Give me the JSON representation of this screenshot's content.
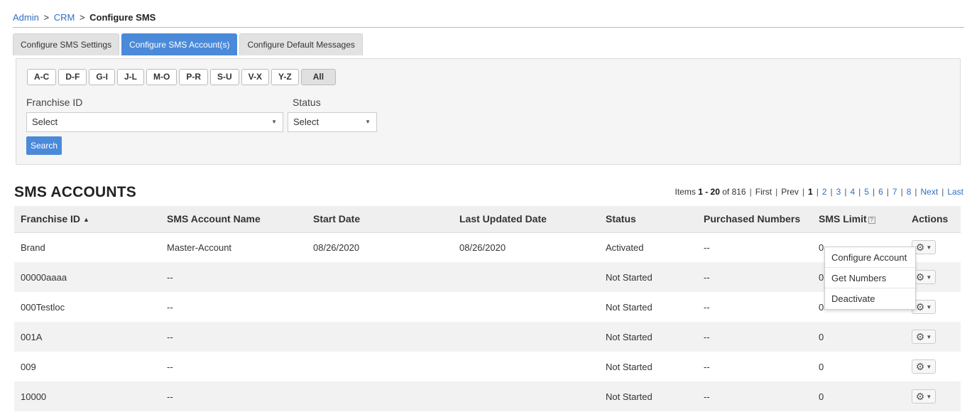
{
  "breadcrumb": {
    "admin": "Admin",
    "sep": ">",
    "crm": "CRM",
    "current": "Configure SMS"
  },
  "tabs": [
    {
      "label": "Configure SMS Settings"
    },
    {
      "label": "Configure SMS Account(s)"
    },
    {
      "label": "Configure Default Messages"
    }
  ],
  "letters": [
    "A-C",
    "D-F",
    "G-I",
    "J-L",
    "M-O",
    "P-R",
    "S-U",
    "V-X",
    "Y-Z",
    "All"
  ],
  "filters": {
    "franchise_label": "Franchise ID",
    "franchise_value": "Select",
    "status_label": "Status",
    "status_value": "Select",
    "search_label": "Search"
  },
  "section_title": "SMS ACCOUNTS",
  "pager": {
    "items_label": "Items",
    "range": "1 - 20",
    "of_label": "of 816",
    "first": "First",
    "prev": "Prev",
    "current": "1",
    "pages": [
      "2",
      "3",
      "4",
      "5",
      "6",
      "7",
      "8"
    ],
    "next": "Next",
    "last": "Last"
  },
  "table": {
    "headers": {
      "franchise_id": "Franchise ID",
      "account_name": "SMS Account Name",
      "start_date": "Start Date",
      "last_updated": "Last Updated Date",
      "status": "Status",
      "purchased": "Purchased Numbers",
      "limit": "SMS Limit",
      "actions": "Actions"
    },
    "rows": [
      {
        "franchise_id": "Brand",
        "account_name": "Master-Account",
        "start_date": "08/26/2020",
        "last_updated": "08/26/2020",
        "status": "Activated",
        "purchased": "--",
        "limit": "0"
      },
      {
        "franchise_id": "00000aaaa",
        "account_name": "--",
        "start_date": "",
        "last_updated": "",
        "status": "Not Started",
        "purchased": "--",
        "limit": "0"
      },
      {
        "franchise_id": "000Testloc",
        "account_name": "--",
        "start_date": "",
        "last_updated": "",
        "status": "Not Started",
        "purchased": "--",
        "limit": "0"
      },
      {
        "franchise_id": "001A",
        "account_name": "--",
        "start_date": "",
        "last_updated": "",
        "status": "Not Started",
        "purchased": "--",
        "limit": "0"
      },
      {
        "franchise_id": "009",
        "account_name": "--",
        "start_date": "",
        "last_updated": "",
        "status": "Not Started",
        "purchased": "--",
        "limit": "0"
      },
      {
        "franchise_id": "10000",
        "account_name": "--",
        "start_date": "",
        "last_updated": "",
        "status": "Not Started",
        "purchased": "--",
        "limit": "0"
      }
    ]
  },
  "actions_menu": [
    "Configure Account",
    "Get Numbers",
    "Deactivate"
  ],
  "icons": {
    "sort": "sort-ascending-icon",
    "help": "help-icon",
    "gear": "gear-icon",
    "caret": "caret-down-icon"
  },
  "colors": {
    "accent": "#4a8ad9",
    "link": "#2f6fc0"
  }
}
